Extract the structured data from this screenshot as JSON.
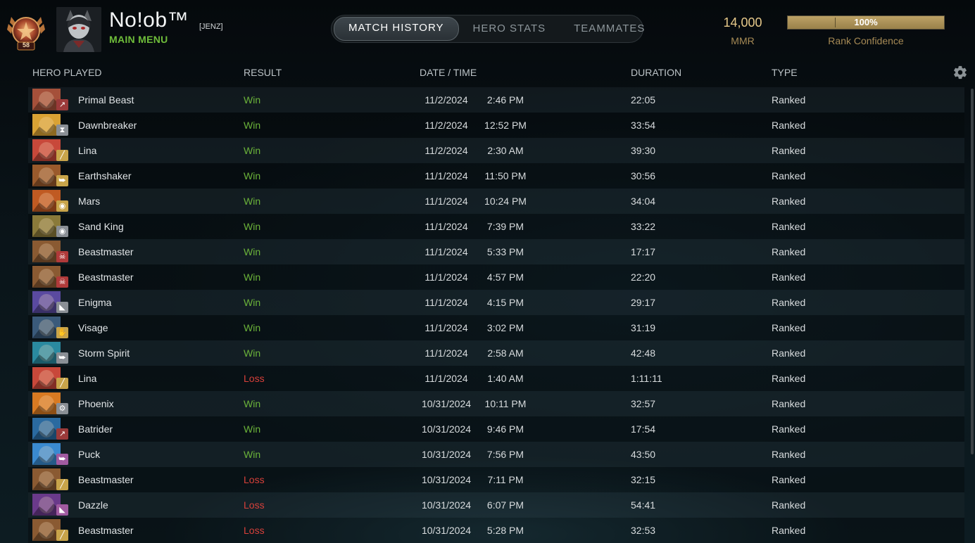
{
  "profile": {
    "level": "58",
    "name": "No!ob™",
    "tag": "[JENZ]",
    "menu_link": "MAIN MENU"
  },
  "tabs": [
    {
      "label": "MATCH HISTORY",
      "active": true
    },
    {
      "label": "HERO STATS",
      "active": false
    },
    {
      "label": "TEAMMATES",
      "active": false
    }
  ],
  "rank": {
    "mmr_value": "14,000",
    "mmr_label": "MMR",
    "confidence_value": "100%",
    "confidence_fraction": 1.0,
    "confidence_label": "Rank Confidence"
  },
  "columns": {
    "hero": "HERO PLAYED",
    "result": "RESULT",
    "datetime": "DATE / TIME",
    "duration": "DURATION",
    "type": "TYPE"
  },
  "settings_icon": "gear-icon",
  "colors": {
    "win": "#6bb33a",
    "loss": "#d8403a",
    "gold": "#e7c98a",
    "menu_green": "#6fbd3a"
  },
  "matches": [
    {
      "hero": "Primal Beast",
      "result": "Win",
      "date": "11/2/2024",
      "time": "2:46 PM",
      "duration": "22:05",
      "type": "Ranked",
      "role_icon": "initiator-icon",
      "hero_color": "#a5503a",
      "role_color": "#9b3a3a"
    },
    {
      "hero": "Dawnbreaker",
      "result": "Win",
      "date": "11/2/2024",
      "time": "12:52 PM",
      "duration": "33:54",
      "type": "Ranked",
      "role_icon": "hourglass-icon",
      "hero_color": "#d9a234",
      "role_color": "#8a8f95"
    },
    {
      "hero": "Lina",
      "result": "Win",
      "date": "11/2/2024",
      "time": "2:30 AM",
      "duration": "39:30",
      "type": "Ranked",
      "role_icon": "sword-icon",
      "hero_color": "#c8483a",
      "role_color": "#c8a44a"
    },
    {
      "hero": "Earthshaker",
      "result": "Win",
      "date": "11/1/2024",
      "time": "11:50 PM",
      "duration": "30:56",
      "type": "Ranked",
      "role_icon": "running-icon",
      "hero_color": "#9a5a2c",
      "role_color": "#c8a44a"
    },
    {
      "hero": "Mars",
      "result": "Win",
      "date": "11/1/2024",
      "time": "10:24 PM",
      "duration": "34:04",
      "type": "Ranked",
      "role_icon": "eye-icon",
      "hero_color": "#c05a22",
      "role_color": "#c8a44a"
    },
    {
      "hero": "Sand King",
      "result": "Win",
      "date": "11/1/2024",
      "time": "7:39 PM",
      "duration": "33:22",
      "type": "Ranked",
      "role_icon": "eye-icon",
      "hero_color": "#8a7a3a",
      "role_color": "#8a8f95"
    },
    {
      "hero": "Beastmaster",
      "result": "Win",
      "date": "11/1/2024",
      "time": "5:33 PM",
      "duration": "17:17",
      "type": "Ranked",
      "role_icon": "skull-icon",
      "hero_color": "#8a5a32",
      "role_color": "#b03a3a"
    },
    {
      "hero": "Beastmaster",
      "result": "Win",
      "date": "11/1/2024",
      "time": "4:57 PM",
      "duration": "22:20",
      "type": "Ranked",
      "role_icon": "skull-icon",
      "hero_color": "#8a5a32",
      "role_color": "#b03a3a"
    },
    {
      "hero": "Enigma",
      "result": "Win",
      "date": "11/1/2024",
      "time": "4:15 PM",
      "duration": "29:17",
      "type": "Ranked",
      "role_icon": "boot-icon",
      "hero_color": "#5a4aa0",
      "role_color": "#8a8f95"
    },
    {
      "hero": "Visage",
      "result": "Win",
      "date": "11/1/2024",
      "time": "3:02 PM",
      "duration": "31:19",
      "type": "Ranked",
      "role_icon": "hand-icon",
      "hero_color": "#3a5a7a",
      "role_color": "#c8a44a"
    },
    {
      "hero": "Storm Spirit",
      "result": "Win",
      "date": "11/1/2024",
      "time": "2:58 AM",
      "duration": "42:48",
      "type": "Ranked",
      "role_icon": "running-icon",
      "hero_color": "#2a8aa0",
      "role_color": "#8a8f95"
    },
    {
      "hero": "Lina",
      "result": "Loss",
      "date": "11/1/2024",
      "time": "1:40 AM",
      "duration": "1:11:11",
      "type": "Ranked",
      "role_icon": "sword-icon",
      "hero_color": "#c8483a",
      "role_color": "#c8a44a"
    },
    {
      "hero": "Phoenix",
      "result": "Win",
      "date": "10/31/2024",
      "time": "10:11 PM",
      "duration": "32:57",
      "type": "Ranked",
      "role_icon": "gear-icon",
      "hero_color": "#d87a22",
      "role_color": "#8a8f95"
    },
    {
      "hero": "Batrider",
      "result": "Win",
      "date": "10/31/2024",
      "time": "9:46 PM",
      "duration": "17:54",
      "type": "Ranked",
      "role_icon": "initiator-icon",
      "hero_color": "#2a6aa0",
      "role_color": "#9b3a3a"
    },
    {
      "hero": "Puck",
      "result": "Win",
      "date": "10/31/2024",
      "time": "7:56 PM",
      "duration": "43:50",
      "type": "Ranked",
      "role_icon": "running-icon",
      "hero_color": "#3a8ad0",
      "role_color": "#a05aa0"
    },
    {
      "hero": "Beastmaster",
      "result": "Loss",
      "date": "10/31/2024",
      "time": "7:11 PM",
      "duration": "32:15",
      "type": "Ranked",
      "role_icon": "sword-icon",
      "hero_color": "#8a5a32",
      "role_color": "#c8a44a"
    },
    {
      "hero": "Dazzle",
      "result": "Loss",
      "date": "10/31/2024",
      "time": "6:07 PM",
      "duration": "54:41",
      "type": "Ranked",
      "role_icon": "boot-icon",
      "hero_color": "#6a3a8a",
      "role_color": "#a05aa0"
    },
    {
      "hero": "Beastmaster",
      "result": "Loss",
      "date": "10/31/2024",
      "time": "5:28 PM",
      "duration": "32:53",
      "type": "Ranked",
      "role_icon": "sword-icon",
      "hero_color": "#8a5a32",
      "role_color": "#c8a44a"
    }
  ]
}
